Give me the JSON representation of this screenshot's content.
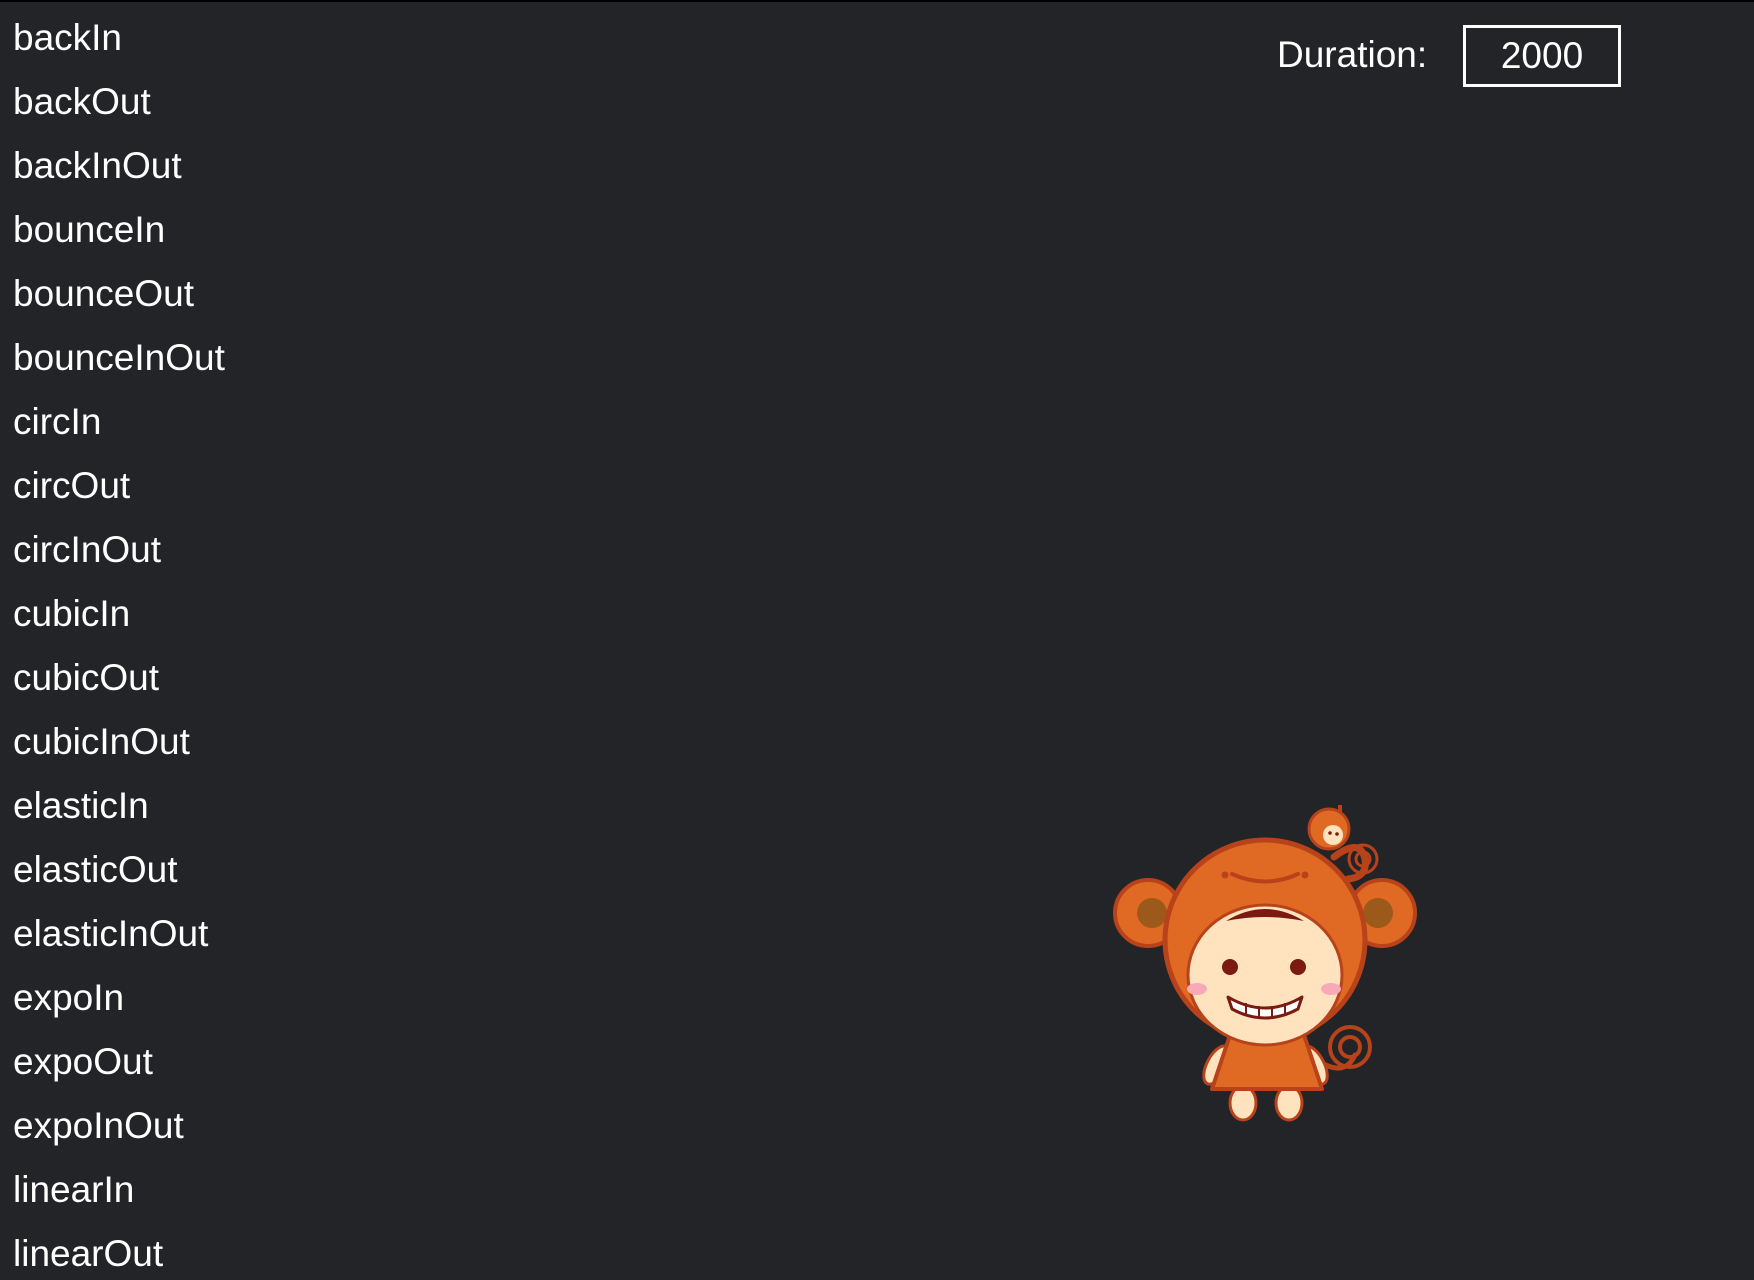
{
  "easing_list": {
    "items": [
      "backIn",
      "backOut",
      "backInOut",
      "bounceIn",
      "bounceOut",
      "bounceInOut",
      "circIn",
      "circOut",
      "circInOut",
      "cubicIn",
      "cubicOut",
      "cubicInOut",
      "elasticIn",
      "elasticOut",
      "elasticInOut",
      "expoIn",
      "expoOut",
      "expoInOut",
      "linearIn",
      "linearOut"
    ]
  },
  "duration": {
    "label": "Duration:",
    "value": "2000"
  },
  "sprite": {
    "name": "monkey-costume-kid",
    "colors": {
      "hood": "#e06a24",
      "outline": "#b8431a",
      "ear_inner": "#9c5a1a",
      "face": "#ffe3bf",
      "blush": "#f7a9b8",
      "eyes": "#7a1a10"
    }
  },
  "theme": {
    "background": "#232427",
    "text": "#ffffff"
  }
}
